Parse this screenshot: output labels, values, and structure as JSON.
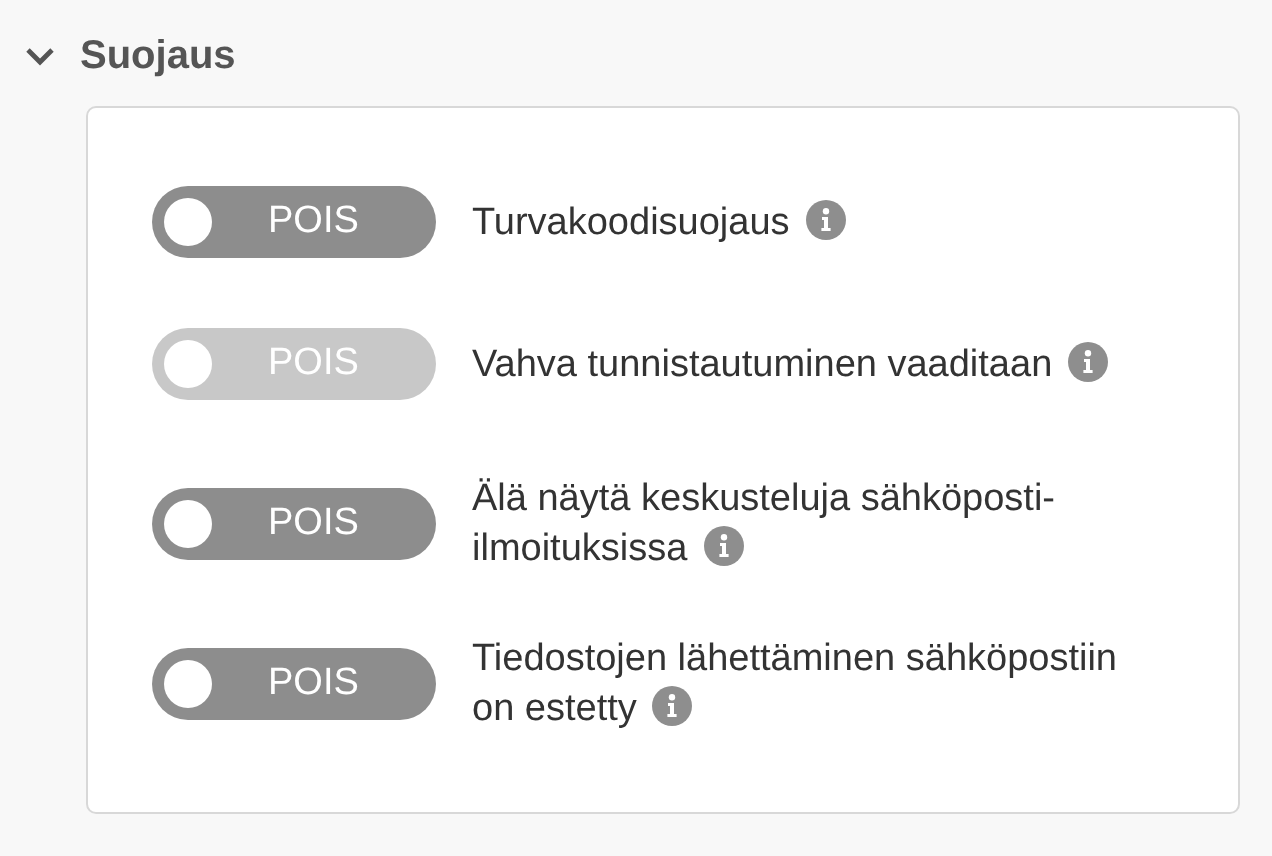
{
  "section": {
    "title": "Suojaus",
    "expanded": true,
    "settings": [
      {
        "label": "Turvakoodisuojaus",
        "on": false,
        "disabled": false,
        "state_text": "POIS"
      },
      {
        "label": "Vahva tunnistautuminen vaaditaan",
        "on": false,
        "disabled": true,
        "state_text": "POIS"
      },
      {
        "label": "Älä näytä keskusteluja sähköposti-ilmoituksissa",
        "on": false,
        "disabled": false,
        "state_text": "POIS"
      },
      {
        "label": "Tiedostojen lähettäminen sähköpostiin on estetty",
        "on": false,
        "disabled": false,
        "state_text": "POIS"
      }
    ]
  }
}
